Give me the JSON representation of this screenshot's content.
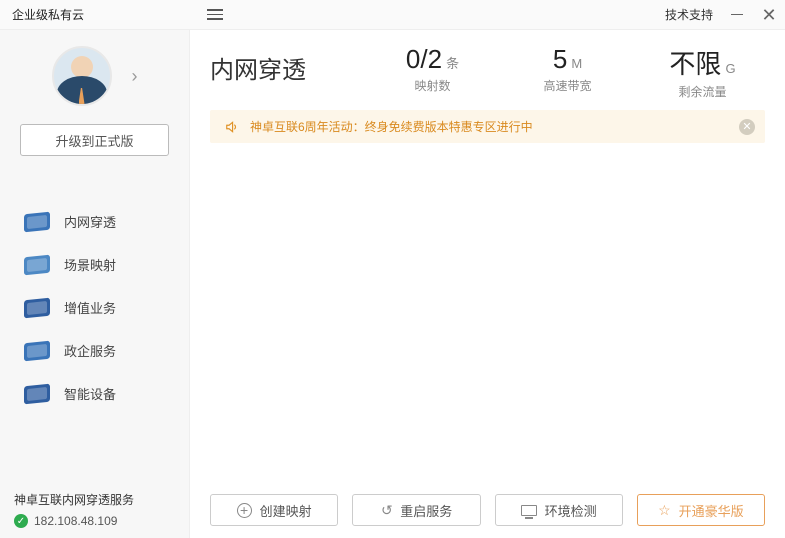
{
  "titlebar": {
    "app_name": "企业级私有云",
    "support_label": "技术支持"
  },
  "sidebar": {
    "upgrade_label": "升级到正式版",
    "nav": [
      {
        "label": "内网穿透"
      },
      {
        "label": "场景映射"
      },
      {
        "label": "增值业务"
      },
      {
        "label": "政企服务"
      },
      {
        "label": "智能设备"
      }
    ],
    "footer_title": "神卓互联内网穿透服务",
    "ip": "182.108.48.109"
  },
  "main": {
    "title": "内网穿透",
    "stats": [
      {
        "value": "0/2",
        "unit": "条",
        "label": "映射数"
      },
      {
        "value": "5",
        "unit": "M",
        "label": "高速带宽"
      },
      {
        "value": "不限",
        "unit": "G",
        "label": "剩余流量"
      }
    ],
    "banner": "神卓互联6周年活动：终身免续费版本特惠专区进行中"
  },
  "bottom": {
    "create": "创建映射",
    "restart": "重启服务",
    "envcheck": "环境检测",
    "premium": "开通豪华版"
  }
}
